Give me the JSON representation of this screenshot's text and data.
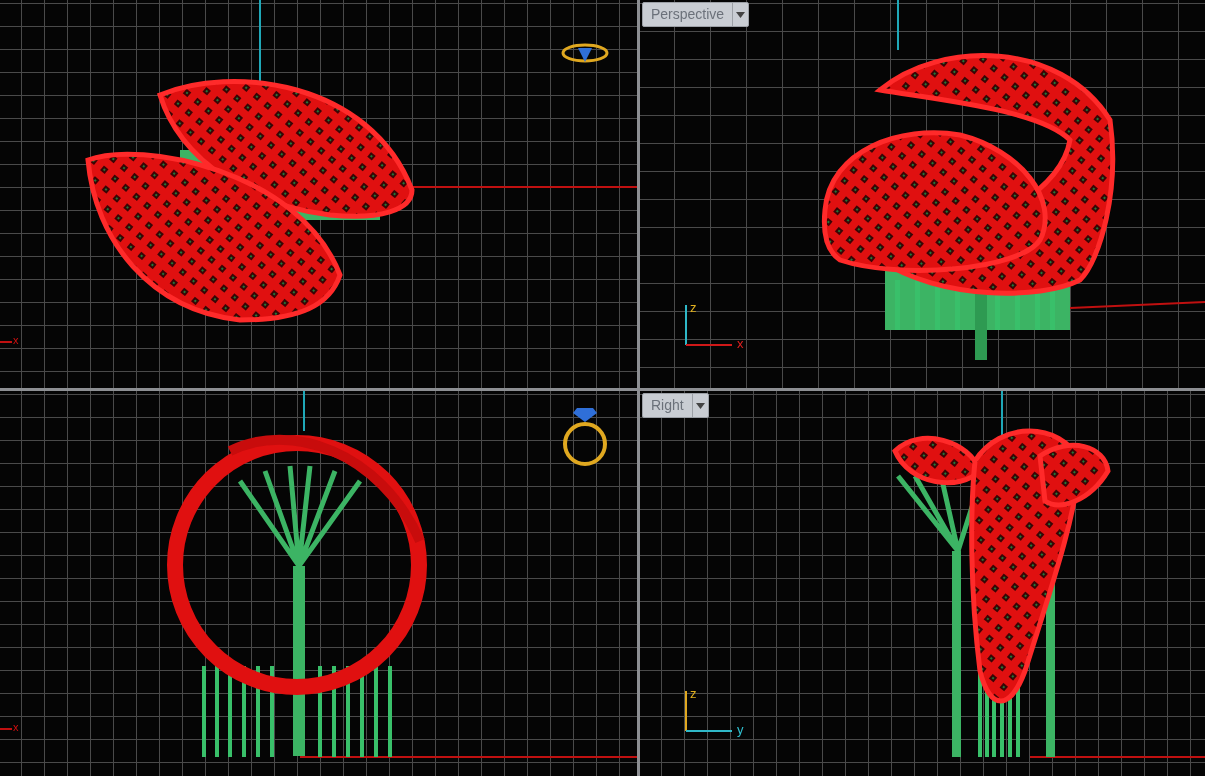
{
  "viewports": [
    {
      "kind": "top",
      "edge_label": "x"
    },
    {
      "kind": "perspective",
      "title": "Perspective",
      "gizmo": {
        "vertical": "z",
        "horizontal": "x"
      }
    },
    {
      "kind": "front",
      "edge_label": "x"
    },
    {
      "kind": "right",
      "title": "Right",
      "gizmo": {
        "vertical": "z",
        "horizontal": "y"
      }
    }
  ]
}
